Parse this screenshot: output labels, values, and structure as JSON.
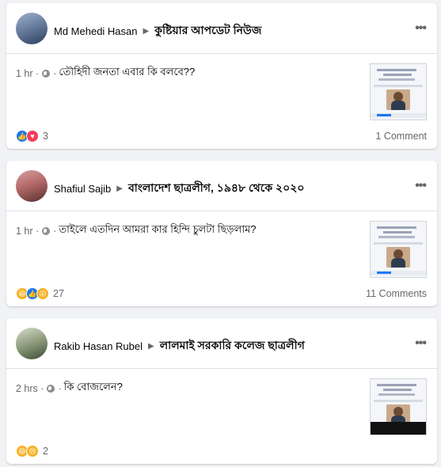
{
  "posts": [
    {
      "author": "Md Mehedi Hasan",
      "group": "কুষ্টিয়ার আপডেট নিউজ",
      "time": "1 hr",
      "text": "তৌহিদী জনতা এবার কি বলবে??",
      "reaction_count": "3",
      "comments": "1 Comment",
      "reactions": [
        "like",
        "love"
      ],
      "avatar_colors": [
        "#6a7fa0",
        "#2c3f5e"
      ]
    },
    {
      "author": "Shafiul Sajib",
      "group": "বাংলাদেশ ছাত্রলীগ, ১৯৪৮ থেকে ২০২০",
      "time": "1 hr",
      "text": "তাইলে এতদিন আমরা কার হিন্দি চুলটা ছিড়লাম?",
      "reaction_count": "27",
      "comments": "11 Comments",
      "reactions": [
        "haha",
        "like",
        "wow"
      ],
      "avatar_colors": [
        "#b56a6a",
        "#5a2e2e"
      ]
    },
    {
      "author": "Rakib Hasan Rubel",
      "group": "লালমাই সরকারি কলেজ ছাত্রলীগ",
      "time": "2 hrs",
      "text": "কি বোজলেন?",
      "reaction_count": "2",
      "comments": "",
      "reactions": [
        "haha",
        "sad"
      ],
      "avatar_colors": [
        "#8c9a7c",
        "#3c4a33"
      ]
    }
  ],
  "colors": {
    "background": "#f0f2f5",
    "card": "#ffffff",
    "secondary_text": "#65676b",
    "like_blue": "#1877f2",
    "love_red": "#f33e58",
    "emoji_yellow": "#f7b125"
  }
}
